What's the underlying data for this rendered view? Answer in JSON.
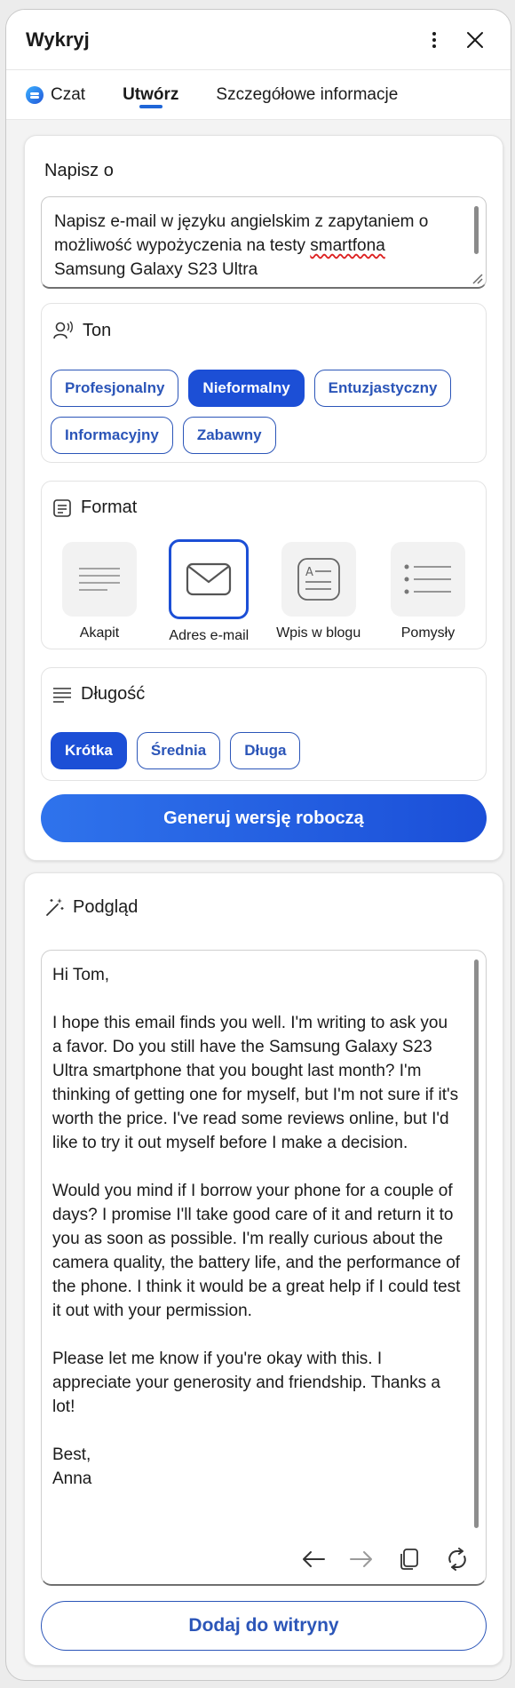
{
  "window": {
    "title": "Wykryj"
  },
  "tabs": [
    {
      "label": "Czat"
    },
    {
      "label": "Utwórz"
    },
    {
      "label": "Szczegółowe informacje"
    }
  ],
  "compose": {
    "prompt_label": "Napisz o",
    "prompt_text_before": "Napisz e-mail w języku angielskim z zapytaniem o możliwość wypożyczenia na testy ",
    "prompt_text_misspelled": "smartfona",
    "prompt_text_after": " Samsung Galaxy S23 Ultra",
    "tone": {
      "label": "Ton",
      "options": [
        "Profesjonalny",
        "Nieformalny",
        "Entuzjastyczny",
        "Informacyjny",
        "Zabawny"
      ],
      "selected": "Nieformalny"
    },
    "format": {
      "label": "Format",
      "options": [
        {
          "label": "Akapit",
          "icon": "paragraph-icon"
        },
        {
          "label": "Adres e-mail",
          "icon": "envelope-icon"
        },
        {
          "label": "Wpis w blogu",
          "icon": "blog-post-icon"
        },
        {
          "label": "Pomysły",
          "icon": "bullet-list-icon"
        }
      ],
      "selected": "Adres e-mail"
    },
    "length": {
      "label": "Długość",
      "options": [
        "Krótka",
        "Średnia",
        "Długa"
      ],
      "selected": "Krótka"
    },
    "generate_label": "Generuj wersję roboczą"
  },
  "preview": {
    "label": "Podgląd",
    "paragraphs": [
      "Hi Tom,",
      "I hope this email finds you well. I'm writing to ask you a favor. Do you still have the Samsung Galaxy S23 Ultra smartphone that you bought last month? I'm thinking of getting one for myself, but I'm not sure if it's worth the price. I've read some reviews online, but I'd like to try it out myself before I make a decision.",
      "Would you mind if I borrow your phone for a couple of days? I promise I'll take good care of it and return it to you as soon as possible. I'm really curious about the camera quality, the battery life, and the performance of the phone. I think it would be a great help if I could test it out with your permission.",
      "Please let me know if you're okay with this. I appreciate your generosity and friendship. Thanks a lot!",
      "Best,\nAnna"
    ],
    "add_label": "Dodaj do witryny"
  },
  "colors": {
    "accent": "#1c4fd6",
    "outline": "#2b55b8"
  }
}
